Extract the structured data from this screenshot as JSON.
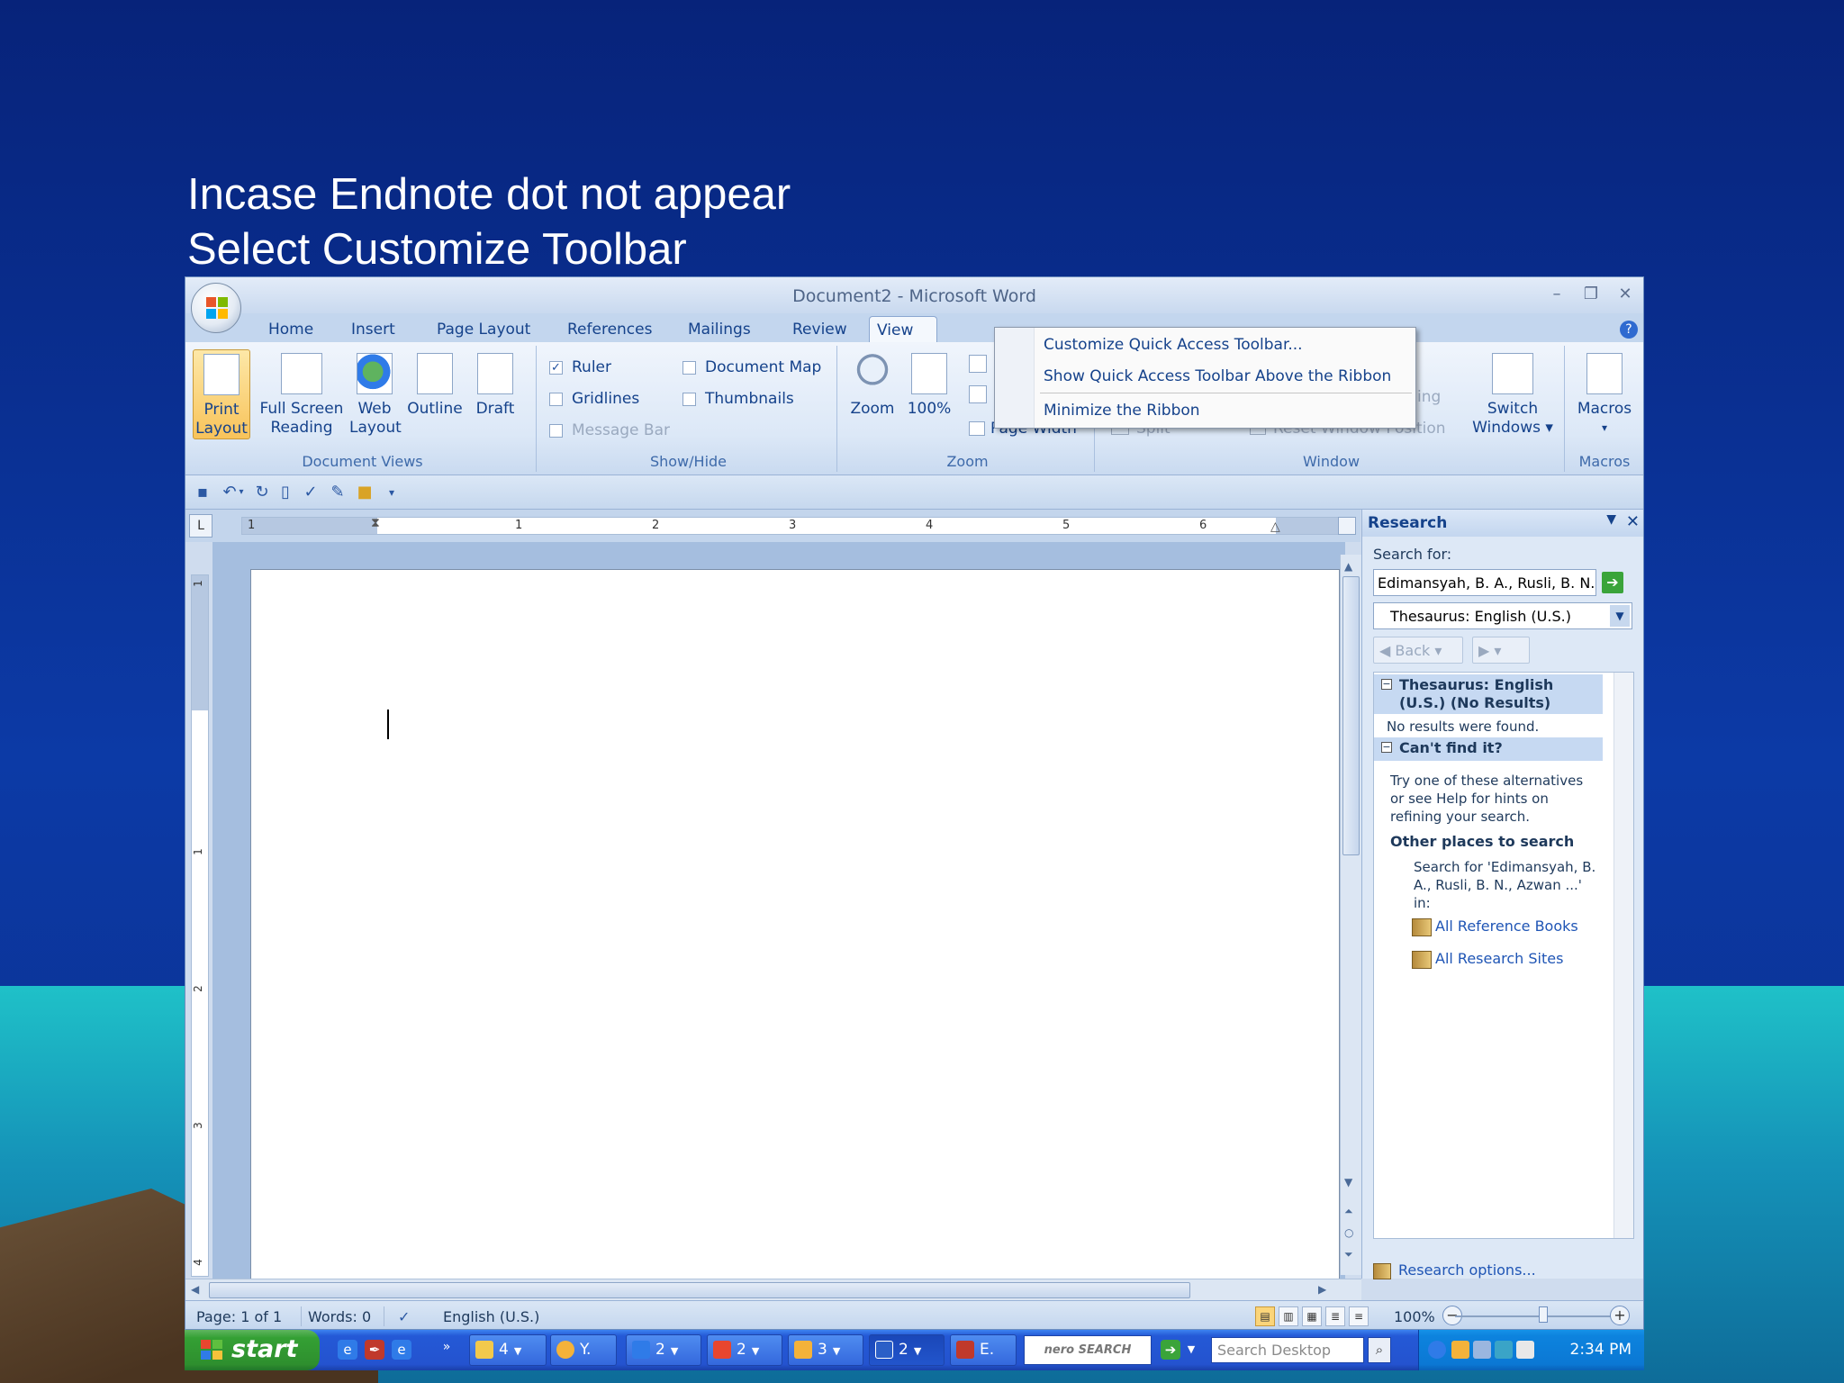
{
  "slide": {
    "title_line1": "Incase Endnote dot not appear",
    "title_line2": "Select Customize Toolbar"
  },
  "window": {
    "title": "Document2 - Microsoft Word",
    "minimize": "–",
    "maximize": "❐",
    "close": "✕",
    "help": "?"
  },
  "tabs": [
    "Home",
    "Insert",
    "Page Layout",
    "References",
    "Mailings",
    "Review",
    "View"
  ],
  "active_tab": "View",
  "ribbon": {
    "document_views": {
      "label": "Document Views",
      "print_layout": [
        "Print",
        "Layout"
      ],
      "full_screen_reading": [
        "Full Screen",
        "Reading"
      ],
      "web_layout": [
        "Web",
        "Layout"
      ],
      "outline": "Outline",
      "draft": "Draft"
    },
    "show_hide": {
      "label": "Show/Hide",
      "ruler": "Ruler",
      "ruler_checked": true,
      "gridlines": "Gridlines",
      "message_bar": "Message Bar",
      "document_map": "Document Map",
      "thumbnails": "Thumbnails"
    },
    "zoom": {
      "label": "Zoom",
      "zoom_btn": "Zoom",
      "hundred": "100%",
      "page_width": "Page Width"
    },
    "window": {
      "label": "Window",
      "split": "Split",
      "reset_window_position": "Reset Window Position",
      "partial": "ing",
      "switch_windows": [
        "Switch",
        "Windows ▾"
      ]
    },
    "macros": {
      "label": "Macros",
      "macros_btn": "Macros",
      "arrow": "▾"
    }
  },
  "context_menu": {
    "items": [
      "Customize Quick Access Toolbar...",
      "Show Quick Access Toolbar Above the Ribbon",
      "Minimize the Ribbon"
    ]
  },
  "quick_access": {
    "icons": [
      "save-icon",
      "undo-icon",
      "redo-icon",
      "new-document-icon",
      "spelling-icon",
      "edit-icon",
      "open-folder-icon",
      "customize-dropdown-icon"
    ]
  },
  "ruler": {
    "numbers": [
      "1",
      "1",
      "2",
      "3",
      "4",
      "5",
      "6"
    ],
    "vnumbers": [
      "1",
      "1",
      "2",
      "3",
      "4"
    ]
  },
  "research": {
    "title": "Research",
    "search_for_label": "Search for:",
    "search_value": "Edimansyah, B. A., Rusli, B. N.,",
    "source": "Thesaurus: English (U.S.)",
    "back": "Back",
    "section1_title": "Thesaurus: English (U.S.) (No Results)",
    "no_results": "No results were found.",
    "section2_title": "Can't find it?",
    "try_text": "Try one of these alternatives or see Help for hints on refining your search.",
    "other_places": "Other places to search",
    "search_for_text": "Search for 'Edimansyah, B. A., Rusli, B. N., Azwan ...' in:",
    "all_reference_books": "All Reference Books",
    "all_research_sites": "All Research Sites",
    "research_options": "Research options..."
  },
  "status": {
    "page": "Page: 1 of 1",
    "words": "Words: 0",
    "language": "English (U.S.)",
    "zoom": "100%",
    "zoom_minus": "−",
    "zoom_plus": "+"
  },
  "taskbar": {
    "start": "start",
    "chevron": "»",
    "buttons": [
      {
        "label": "4",
        "color": "#f2c94c"
      },
      {
        "label": "Y.",
        "color": "#f4b23a"
      },
      {
        "label": "2",
        "color": "#2f7be8"
      },
      {
        "label": "2",
        "color": "#e8462f"
      },
      {
        "label": "3",
        "color": "#f4b23a"
      },
      {
        "label": "2",
        "color": "#2b5fc7"
      },
      {
        "label": "E.",
        "color": "#c0392b"
      }
    ],
    "nero_label": "nero SEARCH",
    "search_placeholder": "Search Desktop",
    "clock": "2:34 PM"
  },
  "colors": {
    "slide_bg": "#0c3aa6",
    "ribbon_blue": "#15428b",
    "taskbar": "#2453cf",
    "start_green": "#34a034"
  }
}
